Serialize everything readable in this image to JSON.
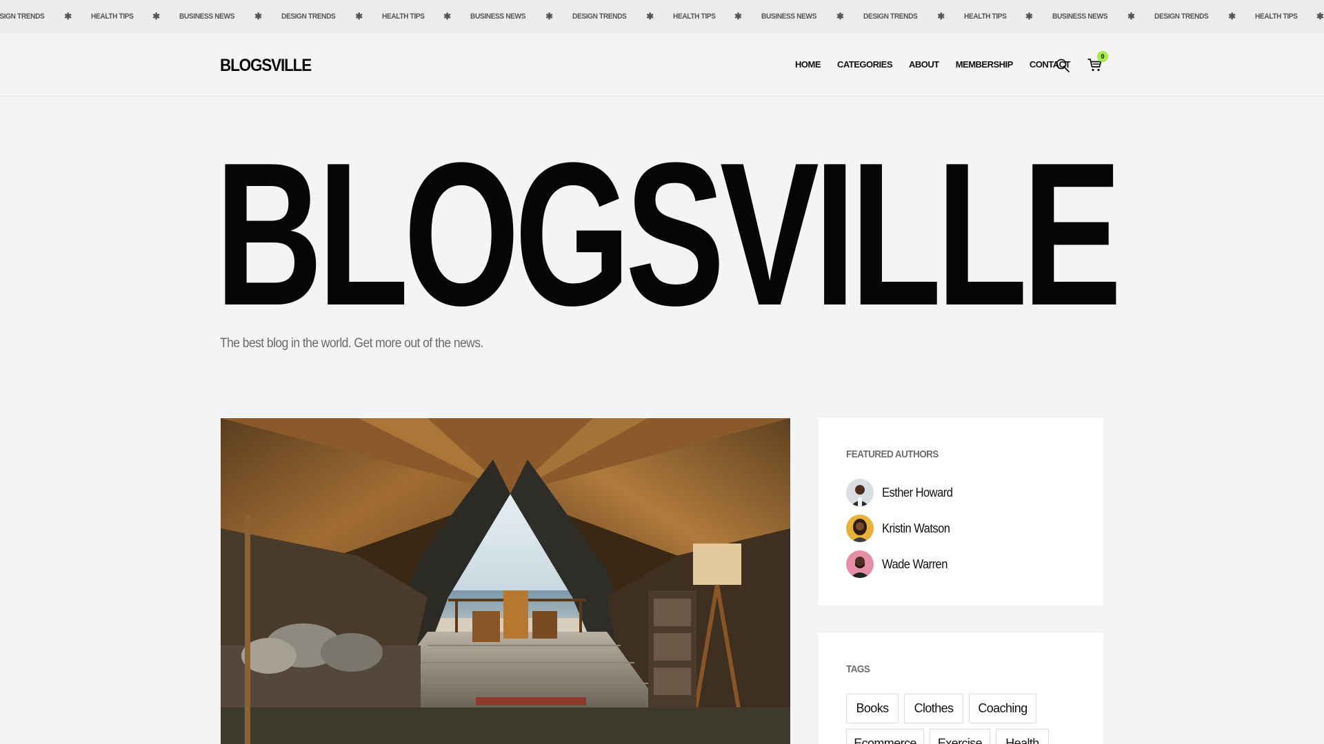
{
  "ticker": {
    "items": [
      "DESIGN TRENDS",
      "HEALTH TIPS",
      "BUSINESS NEWS",
      "DESIGN TRENDS",
      "HEALTH TIPS",
      "BUSINESS NEWS",
      "DESIGN TRENDS",
      "HEALTH TIPS",
      "BUSINESS NEWS",
      "DESIGN TRENDS",
      "HEALTH TIPS",
      "BUSINESS NEWS",
      "DESIGN TRENDS",
      "HEALTH TIPS",
      "BUSINESS NEWS",
      "DESIGN TRENDS"
    ],
    "separator": "✱"
  },
  "header": {
    "logo": "BLOGSVILLE",
    "nav": [
      "HOME",
      "CATEGORIES",
      "ABOUT",
      "MEMBERSHIP",
      "CONTACT"
    ],
    "cart_count": "0",
    "accent": "#a6ec4d"
  },
  "hero": {
    "title": "BLOGSVILLE",
    "tagline": "The best blog in the world. Get more out of the news."
  },
  "sidebar": {
    "authors_title": "FEATURED AUTHORS",
    "authors": [
      {
        "name": "Esther Howard",
        "avatar_color": "#d9dde4"
      },
      {
        "name": "Kristin Watson",
        "avatar_color": "#e7b13a"
      },
      {
        "name": "Wade Warren",
        "avatar_color": "#e58ea8"
      }
    ],
    "tags_title": "TAGS",
    "tags": [
      "Books",
      "Clothes",
      "Coaching",
      "Ecommerce",
      "Exercise",
      "Health"
    ]
  }
}
